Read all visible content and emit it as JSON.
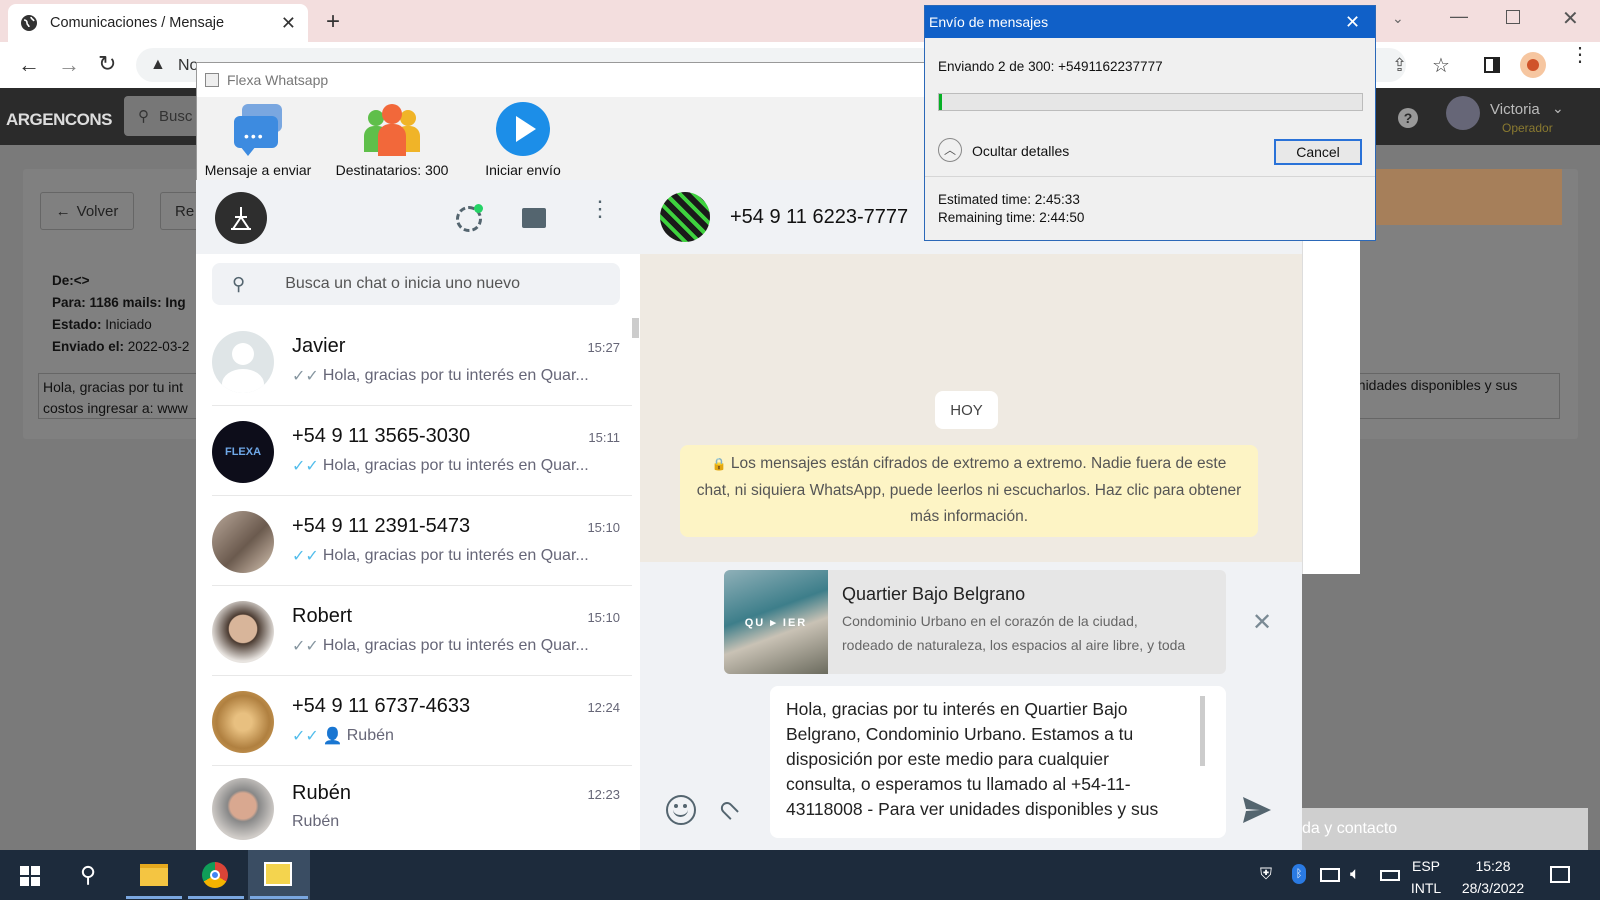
{
  "browser": {
    "tab_title": "Comunicaciones / Mensaje",
    "omni_prefix": "No",
    "site_logo": "ARGENCONS",
    "search_placeholder": "Busc",
    "user_name": "Victoria",
    "user_role": "Operador"
  },
  "page": {
    "back_button": "Volver",
    "second_button": "Re",
    "de_label": "De:<>",
    "para_label": "Para: 1186 mails: Ing",
    "estado_label": "Estado:",
    "estado_value": "Iniciado",
    "enviado_label": "Enviado el:",
    "enviado_value": "2022-03-2",
    "message_line1": "Hola, gracias por tu int",
    "message_line2": "costos ingresar a: www",
    "message_right": "unidades disponibles y sus",
    "contact_bar": "da y contacto"
  },
  "flexa": {
    "title": "Flexa Whatsapp",
    "btn_mensaje": "Mensaje a enviar",
    "btn_destinatarios": "Destinatarios: 300",
    "btn_iniciar": "Iniciar envío"
  },
  "whatsapp": {
    "search_placeholder": "Busca un chat o inicia uno nuevo",
    "chats": [
      {
        "name": "Javier",
        "time": "15:27",
        "msg": "Hola, gracias por tu interés en Quar..."
      },
      {
        "name": "+54 9 11 3565-3030",
        "time": "15:11",
        "msg": "Hola, gracias por tu interés en Quar..."
      },
      {
        "name": "+54 9 11 2391-5473",
        "time": "15:10",
        "msg": "Hola, gracias por tu interés en Quar..."
      },
      {
        "name": "Robert",
        "time": "15:10",
        "msg": "Hola, gracias por tu interés en Quar..."
      },
      {
        "name": "+54 9 11 6737-4633",
        "time": "12:24",
        "msg": "Rubén"
      },
      {
        "name": "Rubén",
        "time": "12:23",
        "msg": "Rubén"
      }
    ],
    "active_contact": "+54 9 11 6223-7777",
    "day_label": "HOY",
    "encryption_notice": "Los mensajes están cifrados de extremo a extremo. Nadie fuera de este chat, ni siquiera WhatsApp, puede leerlos ni escucharlos. Haz clic para obtener más información.",
    "preview_title": "Quartier Bajo Belgrano",
    "preview_desc_line1": "Condominio Urbano en el corazón de la ciudad,",
    "preview_desc_line2": "rodeado de naturaleza, los espacios al aire libre, y toda",
    "preview_image_text": "QU ▸ IER",
    "draft_lines": [
      "Hola, gracias por tu interés en Quartier Bajo",
      "Belgrano, Condominio Urbano. Estamos a tu",
      "disposición por este medio para cualquier",
      "consulta, o esperamos tu llamado al +54-11-",
      "43118008  - Para ver unidades disponibles y sus"
    ]
  },
  "dialog": {
    "title": "Envío de mensajes",
    "status": "Enviando 2 de 300: +5491162237777",
    "progress": 0.007,
    "details_toggle": "Ocultar detalles",
    "cancel_button": "Cancel",
    "estimated": "Estimated time: 2:45:33",
    "remaining": "Remaining time: 2:44:50"
  },
  "taskbar": {
    "lang1": "ESP",
    "lang2": "INTL",
    "time": "15:28",
    "date": "28/3/2022"
  },
  "colors": {
    "whatsapp_check": "#53bdeb",
    "dialog_title": "#1060c8",
    "play_blue": "#1c8ee8"
  }
}
